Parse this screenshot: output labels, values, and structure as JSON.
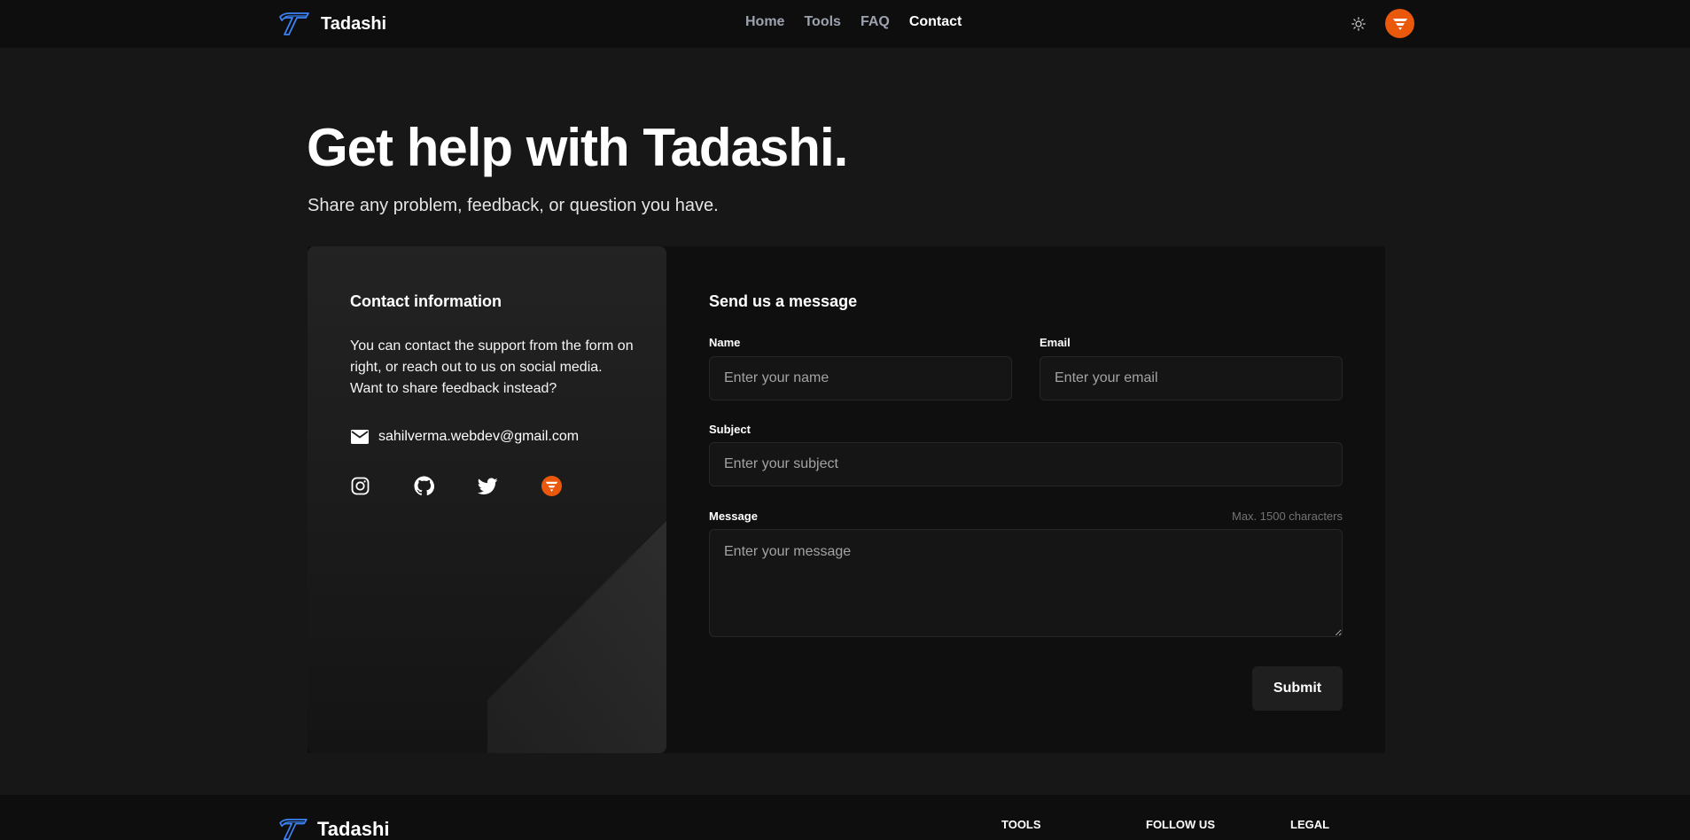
{
  "header": {
    "brand": "Tadashi",
    "nav": [
      {
        "label": "Home",
        "active": false
      },
      {
        "label": "Tools",
        "active": false
      },
      {
        "label": "FAQ",
        "active": false
      },
      {
        "label": "Contact",
        "active": true
      }
    ],
    "theme_icon": "sun-icon",
    "avatar_icon": "tadashi-badge-icon"
  },
  "hero": {
    "title": "Get help with Tadashi.",
    "subtitle": "Share any problem, feedback, or question you have."
  },
  "contact_info": {
    "title": "Contact information",
    "text": "You can contact the support from the form on right, or reach out to us on social media. Want to share feedback instead?",
    "email": "sahilverma.webdev@gmail.com",
    "socials": [
      "instagram-icon",
      "github-icon",
      "twitter-icon",
      "tadashi-badge-icon"
    ]
  },
  "form": {
    "title": "Send us a message",
    "name": {
      "label": "Name",
      "placeholder": "Enter your name",
      "value": ""
    },
    "email": {
      "label": "Email",
      "placeholder": "Enter your email",
      "value": ""
    },
    "subject": {
      "label": "Subject",
      "placeholder": "Enter your subject",
      "value": ""
    },
    "message": {
      "label": "Message",
      "hint": "Max. 1500 characters",
      "placeholder": "Enter your message",
      "value": ""
    },
    "submit_label": "Submit"
  },
  "footer": {
    "brand": "Tadashi",
    "columns": [
      "TOOLS",
      "FOLLOW US",
      "LEGAL"
    ]
  },
  "colors": {
    "accent": "#ea580c",
    "logo_blue": "#3b82f6",
    "background": "#171717"
  }
}
